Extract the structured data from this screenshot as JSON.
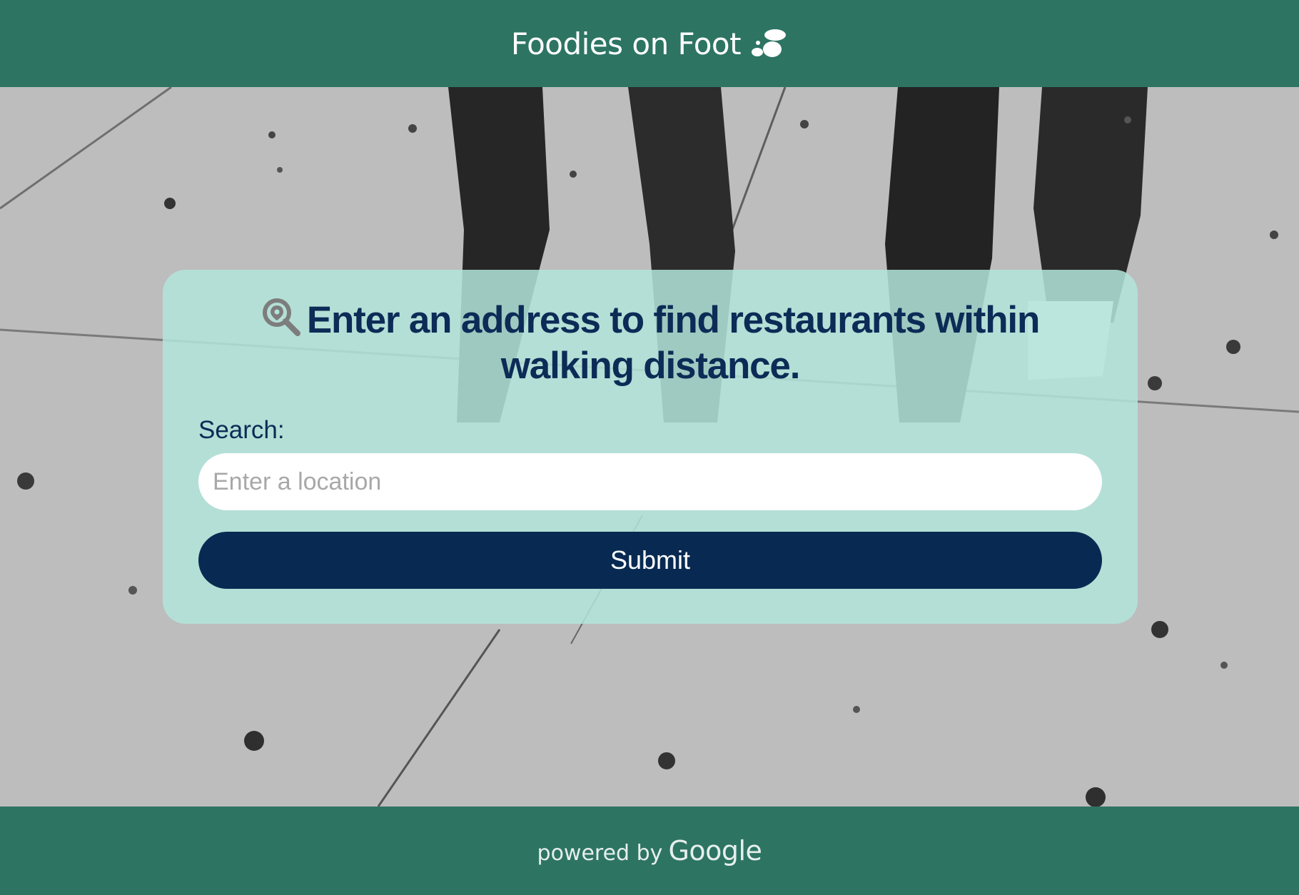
{
  "header": {
    "title": "Foodies on Foot",
    "icon": "footprints-icon",
    "background": "#2d7463"
  },
  "background": {
    "image": "black-and-white-photo-of-legs-walking-on-sidewalk"
  },
  "card": {
    "icon": "magnifier-location-icon",
    "headline": "Enter an address to find restaurants within walking distance.",
    "search_label": "Search:",
    "search_placeholder": "Enter a location",
    "search_value": "",
    "submit_label": "Submit",
    "colors": {
      "card": "#b2e4da",
      "heading": "#0c2b56",
      "button": "#082a52"
    }
  },
  "footer": {
    "attribution_prefix": "powered by",
    "attribution_brand": "Google"
  }
}
